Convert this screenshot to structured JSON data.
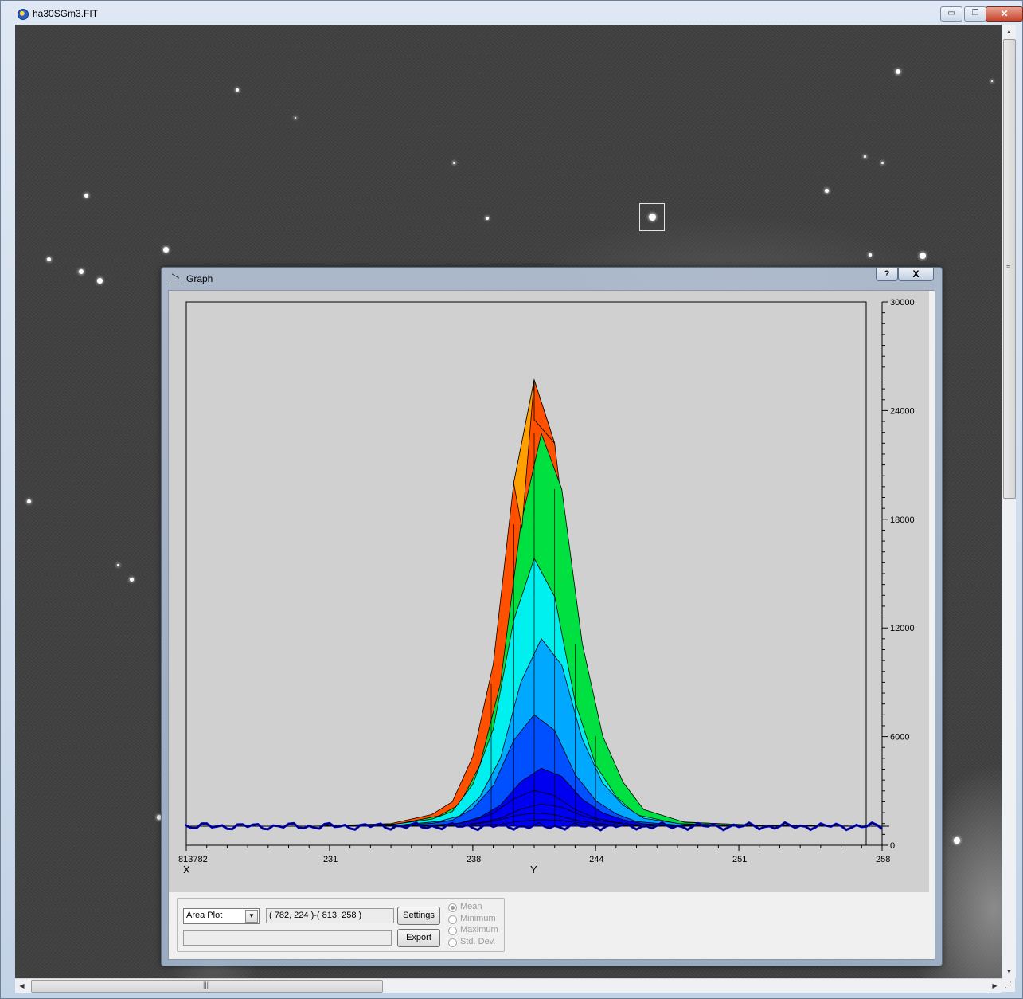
{
  "window": {
    "title": "ha30SGm3.FIT",
    "minimize_label": "▭",
    "restore_label": "❐",
    "close_label": "✕"
  },
  "graph_dialog": {
    "title": "Graph",
    "help_label": "?",
    "close_label": "X",
    "plot_type_selected": "Area Plot",
    "region_text": "( 782, 224 )-( 813, 258 )",
    "settings_label": "Settings",
    "export_label": "Export",
    "radio_options": [
      {
        "label": "Mean",
        "selected": true
      },
      {
        "label": "Minimum",
        "selected": false
      },
      {
        "label": "Maximum",
        "selected": false
      },
      {
        "label": "Std. Dev.",
        "selected": false
      }
    ]
  },
  "chart_data": {
    "type": "area",
    "plot_style": "3D surface area plot of pixel intensity",
    "y_axis_ticks": [
      "0",
      "6000",
      "12000",
      "18000",
      "24000",
      "30000"
    ],
    "ylim": [
      0,
      30000
    ],
    "x_axis_ticks": [
      "813782",
      "231",
      "238",
      "244",
      "251",
      "258"
    ],
    "x_label": "X",
    "y_label": "Y",
    "y_coord_range": [
      224,
      258
    ],
    "x_coord_range": [
      782,
      813
    ],
    "peak_value": 25700,
    "peak_y": 241,
    "background_level": 1050,
    "profile_y": [
      224,
      230,
      234,
      236,
      237,
      238,
      239,
      240,
      241,
      242,
      243,
      244,
      245,
      246,
      248,
      252,
      258
    ],
    "profile_values": [
      1050,
      1050,
      1200,
      1700,
      2400,
      4900,
      10000,
      20000,
      25700,
      22200,
      12500,
      6700,
      3800,
      2100,
      1300,
      1100,
      1050
    ],
    "color_scale": [
      "#0000f0",
      "#0050ff",
      "#00a8ff",
      "#00f0f0",
      "#00e040",
      "#80f000",
      "#ffa000",
      "#ff5000"
    ]
  }
}
